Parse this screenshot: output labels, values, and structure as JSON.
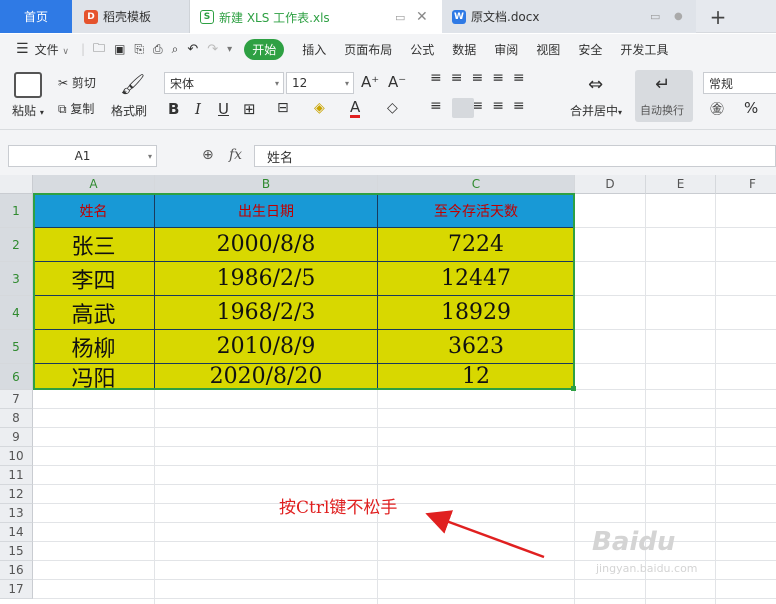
{
  "tabs": [
    {
      "label": "首页"
    },
    {
      "label": "稻壳模板",
      "icon": "docer-icon"
    },
    {
      "label": "新建 XLS 工作表.xls",
      "icon": "spreadsheet-icon"
    },
    {
      "label": "原文档.docx",
      "icon": "word-doc-icon"
    }
  ],
  "menu": {
    "file": "文件",
    "items": [
      "开始",
      "插入",
      "页面布局",
      "公式",
      "数据",
      "审阅",
      "视图",
      "安全",
      "开发工具"
    ],
    "active": "开始"
  },
  "ribbon": {
    "paste": "粘贴",
    "cut": "剪切",
    "copy": "复制",
    "format_painter": "格式刷",
    "font_name": "宋体",
    "font_size": "12",
    "merge": "合并居中",
    "wrap": "自动换行",
    "number_format": "常规",
    "percent": "%"
  },
  "formula_bar": {
    "cell_ref": "A1",
    "fx": "fx",
    "content": "姓名"
  },
  "columns": [
    "A",
    "B",
    "C",
    "D",
    "E",
    "F"
  ],
  "rows": [
    "1",
    "2",
    "3",
    "4",
    "5",
    "6",
    "7",
    "8",
    "9",
    "10",
    "11",
    "12",
    "13",
    "14",
    "15",
    "16",
    "17"
  ],
  "table": {
    "headers": [
      "姓名",
      "出生日期",
      "至今存活天数"
    ],
    "rows": [
      [
        "张三",
        "2000/8/8",
        "7224"
      ],
      [
        "李四",
        "1986/2/5",
        "12447"
      ],
      [
        "高武",
        "1968/2/3",
        "18929"
      ],
      [
        "杨柳",
        "2010/8/9",
        "3623"
      ],
      [
        "冯阳",
        "2020/8/20",
        "12"
      ]
    ]
  },
  "annotation": {
    "text": "按Ctrl键不松手",
    "color": "#e02020"
  },
  "colors": {
    "header_fill": "#1899d6",
    "data_fill": "#d8d800",
    "accent": "#2f7ae5",
    "active_tab_green": "#2ea043"
  }
}
